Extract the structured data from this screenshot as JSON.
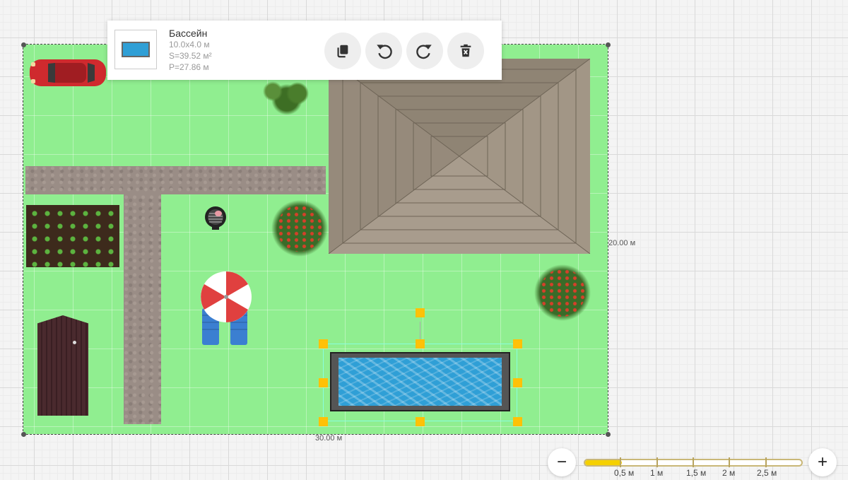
{
  "toolbar": {
    "object_name": "Бассейн",
    "dimensions": "10.0x4.0 м",
    "area": "S=39.52 м²",
    "perimeter": "P=27.86 м",
    "buttons": {
      "copy": "copy-icon",
      "undo": "undo-icon",
      "redo": "redo-icon",
      "delete": "delete-icon"
    }
  },
  "plot": {
    "width_label": "30.00 м",
    "height_label": "20.00 м",
    "fill_color": "#90ee90"
  },
  "zoom": {
    "minus": "−",
    "plus": "+",
    "level_fraction": 0.17,
    "scale_labels": [
      "0,5 м",
      "1 м",
      "1,5 м",
      "2 м",
      "2,5 м"
    ]
  },
  "colors": {
    "selection_handle": "#ffc107",
    "pool_water": "#2f9fd6",
    "scale_fill": "#f5d000"
  }
}
